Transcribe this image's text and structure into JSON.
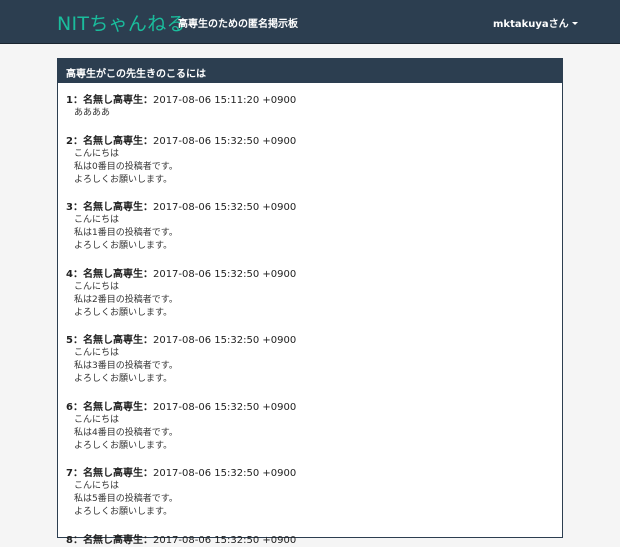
{
  "navbar": {
    "brand": "NITちゃんねる",
    "tagline": "高専生のための匿名掲示板",
    "user": "mktakuyaさん"
  },
  "thread": {
    "title": "高専生がこの先生きのこるには",
    "posts": [
      {
        "num": "1：",
        "name": "名無し高専生",
        "sep": "：",
        "date": "2017-08-06 15:11:20 +0900",
        "lines": [
          "ああああ"
        ]
      },
      {
        "num": "2：",
        "name": "名無し高専生",
        "sep": "：",
        "date": "2017-08-06 15:32:50 +0900",
        "lines": [
          "こんにちは",
          "私は0番目の投稿者です。",
          "よろしくお願いします。"
        ]
      },
      {
        "num": "3：",
        "name": "名無し高専生",
        "sep": "：",
        "date": "2017-08-06 15:32:50 +0900",
        "lines": [
          "こんにちは",
          "私は1番目の投稿者です。",
          "よろしくお願いします。"
        ]
      },
      {
        "num": "4：",
        "name": "名無し高専生",
        "sep": "：",
        "date": "2017-08-06 15:32:50 +0900",
        "lines": [
          "こんにちは",
          "私は2番目の投稿者です。",
          "よろしくお願いします。"
        ]
      },
      {
        "num": "5：",
        "name": "名無し高専生",
        "sep": "：",
        "date": "2017-08-06 15:32:50 +0900",
        "lines": [
          "こんにちは",
          "私は3番目の投稿者です。",
          "よろしくお願いします。"
        ]
      },
      {
        "num": "6：",
        "name": "名無し高専生",
        "sep": "：",
        "date": "2017-08-06 15:32:50 +0900",
        "lines": [
          "こんにちは",
          "私は4番目の投稿者です。",
          "よろしくお願いします。"
        ]
      },
      {
        "num": "7：",
        "name": "名無し高専生",
        "sep": "：",
        "date": "2017-08-06 15:32:50 +0900",
        "lines": [
          "こんにちは",
          "私は5番目の投稿者です。",
          "よろしくお願いします。"
        ]
      },
      {
        "num": "8：",
        "name": "名無し高専生",
        "sep": "：",
        "date": "2017-08-06 15:32:50 +0900",
        "lines": []
      }
    ]
  }
}
